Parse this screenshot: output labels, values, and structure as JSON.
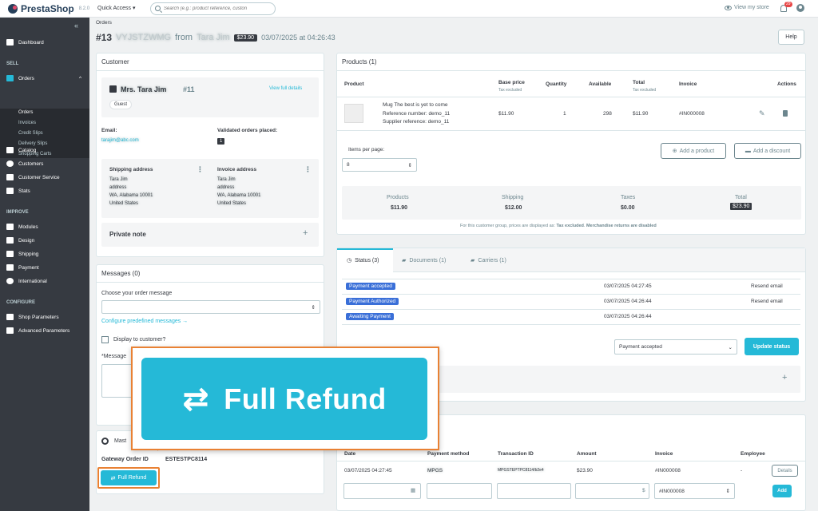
{
  "app": {
    "name": "PrestaShop",
    "version": "8.2.0"
  },
  "topbar": {
    "quick_access": "Quick Access ▾",
    "search_placeholder": "Search (e.g.: product reference, custon",
    "view_store": "View my store",
    "notif_count": "29"
  },
  "sidebar": {
    "collapse": "«",
    "dashboard": "Dashboard",
    "sell_header": "SELL",
    "orders": "Orders",
    "orders_caret": "^",
    "sub": [
      "Orders",
      "Invoices",
      "Credit Slips",
      "Delivery Slips",
      "Shopping Carts"
    ],
    "catalog": "Catalog",
    "customers": "Customers",
    "customer_service": "Customer Service",
    "stats": "Stats",
    "improve_header": "IMPROVE",
    "modules": "Modules",
    "design": "Design",
    "shipping": "Shipping",
    "payment": "Payment",
    "international": "International",
    "configure_header": "CONFIGURE",
    "shop_params": "Shop Parameters",
    "adv_params": "Advanced Parameters"
  },
  "header": {
    "breadcrumb": "Orders",
    "order_num": "#13",
    "order_ref": "VYJSTZWMG",
    "from": "from",
    "customer": "Tara Jim",
    "total": "$23.90",
    "date": "03/07/2025 at 04:26:43",
    "help": "Help"
  },
  "customer": {
    "title": "Customer",
    "name": "Mrs. Tara Jim",
    "id": "#11",
    "view_full": "View full details",
    "guest": "Guest",
    "email_label": "Email:",
    "email": "tarajim@abc.com",
    "validated_label": "Validated orders placed:",
    "validated_count": "1",
    "ship_label": "Shipping address",
    "inv_label": "Invoice address",
    "ship_addr": [
      "Tara Jim",
      "address",
      "WA, Alabama 10001",
      "United States"
    ],
    "inv_addr": [
      "Tara Jim",
      "address",
      "WA, Alabama 10001",
      "United States"
    ],
    "private_note": "Private note"
  },
  "messages": {
    "title": "Messages (0)",
    "choose": "Choose your order message",
    "configure": "Configure predefined messages →",
    "display": "Display to customer?",
    "message_label": "*Message"
  },
  "payment_module": {
    "title": "Mast",
    "gateway_label": "Gateway Order ID",
    "gateway_value": "ESTESTPC8114",
    "full_refund": "Full Refund"
  },
  "products": {
    "title": "Products (1)",
    "headers": {
      "product": "Product",
      "base_price": "Base price",
      "base_sub": "Tax excluded",
      "quantity": "Quantity",
      "available": "Available",
      "total": "Total",
      "total_sub": "Tax excluded",
      "invoice": "Invoice",
      "actions": "Actions"
    },
    "row": {
      "name": "Mug The best is yet to come",
      "ref": "Reference number: demo_11",
      "supplier": "Supplier reference: demo_11",
      "price": "$11.90",
      "qty": "1",
      "available": "298",
      "total": "$11.90",
      "invoice": "#IN000008"
    },
    "items_per_page": "Items per page:",
    "per_page_value": "8",
    "add_product": "Add a product",
    "add_discount": "Add a discount",
    "summary": {
      "products_label": "Products",
      "products": "$11.90",
      "shipping_label": "Shipping",
      "shipping": "$12.00",
      "taxes_label": "Taxes",
      "taxes": "$0.00",
      "total_label": "Total",
      "total": "$23.90"
    },
    "note_prefix": "For this customer group, prices are displayed as: ",
    "note_bold1": "Tax excluded",
    "note_mid": ". ",
    "note_bold2": "Merchandise returns are disabled"
  },
  "status": {
    "tabs": [
      "Status (3)",
      "Documents (1)",
      "Carriers (1)"
    ],
    "rows": [
      {
        "label": "Payment accepted",
        "date": "03/07/2025 04:27:45",
        "action": "Resend email"
      },
      {
        "label": "Payment Authorized",
        "date": "03/07/2025 04:26:44",
        "action": "Resend email"
      },
      {
        "label": "Awaiting Payment",
        "date": "03/07/2025 04:26:44",
        "action": ""
      }
    ],
    "select_value": "Payment accepted",
    "update": "Update status"
  },
  "payments": {
    "headers": [
      "Date",
      "Payment method",
      "Transaction ID",
      "Amount",
      "Invoice",
      "Employee"
    ],
    "row": {
      "date": "03/07/2025 04:27:45",
      "method": "MPGS",
      "txn": "MPGSTEPTPC8114/b2e4",
      "amount": "$23.90",
      "invoice": "#IN000008",
      "employee": "-",
      "details": "Details"
    },
    "currency": "$",
    "invoice_select": "#IN000008",
    "add": "Add"
  },
  "callout": {
    "label": "Full Refund",
    "icon": "⇄"
  }
}
